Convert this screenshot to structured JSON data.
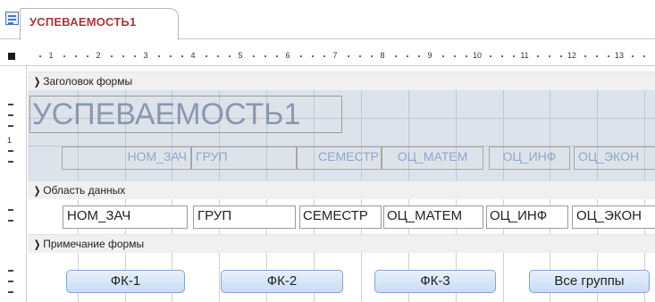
{
  "tab": {
    "icon": "form-icon",
    "title": "УСПЕВАЕМОСТЬ1"
  },
  "ruler": {
    "numbers": [
      "1",
      "2",
      "3",
      "4",
      "5",
      "6",
      "7",
      "8",
      "9",
      "10",
      "11",
      "12",
      "13"
    ],
    "left_number": "1"
  },
  "sections": {
    "header": {
      "label": "Заголовок формы"
    },
    "detail": {
      "label": "Область данных"
    },
    "footer": {
      "label": "Примечание формы"
    }
  },
  "header_controls": {
    "title": "УСПЕВАЕМОСТЬ1",
    "labels": [
      "НОМ_ЗАЧ",
      "ГРУП",
      "СЕМЕСТР",
      "ОЦ_МАТЕМ",
      "ОЦ_ИНФ",
      "ОЦ_ЭКОН"
    ]
  },
  "detail_fields": [
    "НОМ_ЗАЧ",
    "ГРУП",
    "СЕМЕСТР",
    "ОЦ_МАТЕМ",
    "ОЦ_ИНФ",
    "ОЦ_ЭКОН"
  ],
  "footer_buttons": [
    "ФК-1",
    "ФК-2",
    "ФК-3",
    "Все группы"
  ],
  "colors": {
    "tab_title": "#a4373a",
    "header_bg": "#dee3eb",
    "button_border": "#7fa5d0"
  }
}
